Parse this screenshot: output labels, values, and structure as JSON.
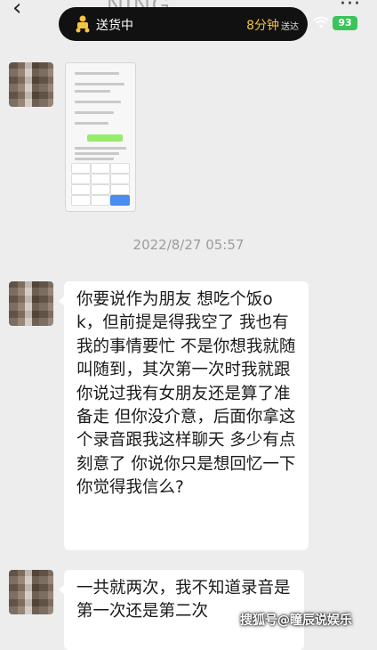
{
  "header": {
    "back_icon": "chevron-left-icon",
    "title_partial": "NING",
    "more_icon": "ellipsis-icon"
  },
  "delivery_pill": {
    "icon": "delivery-rider-icon",
    "status": "送货中",
    "eta": "8分钟",
    "eta_suffix": "送达",
    "accent": "#f6c344"
  },
  "system": {
    "battery": "93",
    "battery_color": "#3cc35a",
    "wifi_icon": "wifi-icon"
  },
  "chat": {
    "timestamp": "2022/8/27 05:57",
    "messages": [
      {
        "type": "image",
        "sender": "other"
      },
      {
        "type": "text",
        "sender": "other",
        "text": "你要说作为朋友 想吃个饭ok，但前提是得我空了 我也有我的事情要忙 不是你想我就随叫随到，其次第一次时我就跟你说过我有女朋友还是算了准备走 但你没介意，后面你拿这个录音跟我这样聊天 多少有点刻意了 你说你只是想回忆一下 你觉得我信么?"
      },
      {
        "type": "text",
        "sender": "other",
        "text": "一共就两次，我不知道录音是第一次还是第二次"
      }
    ]
  },
  "watermark": "搜狐号@瞳辰说娱乐"
}
